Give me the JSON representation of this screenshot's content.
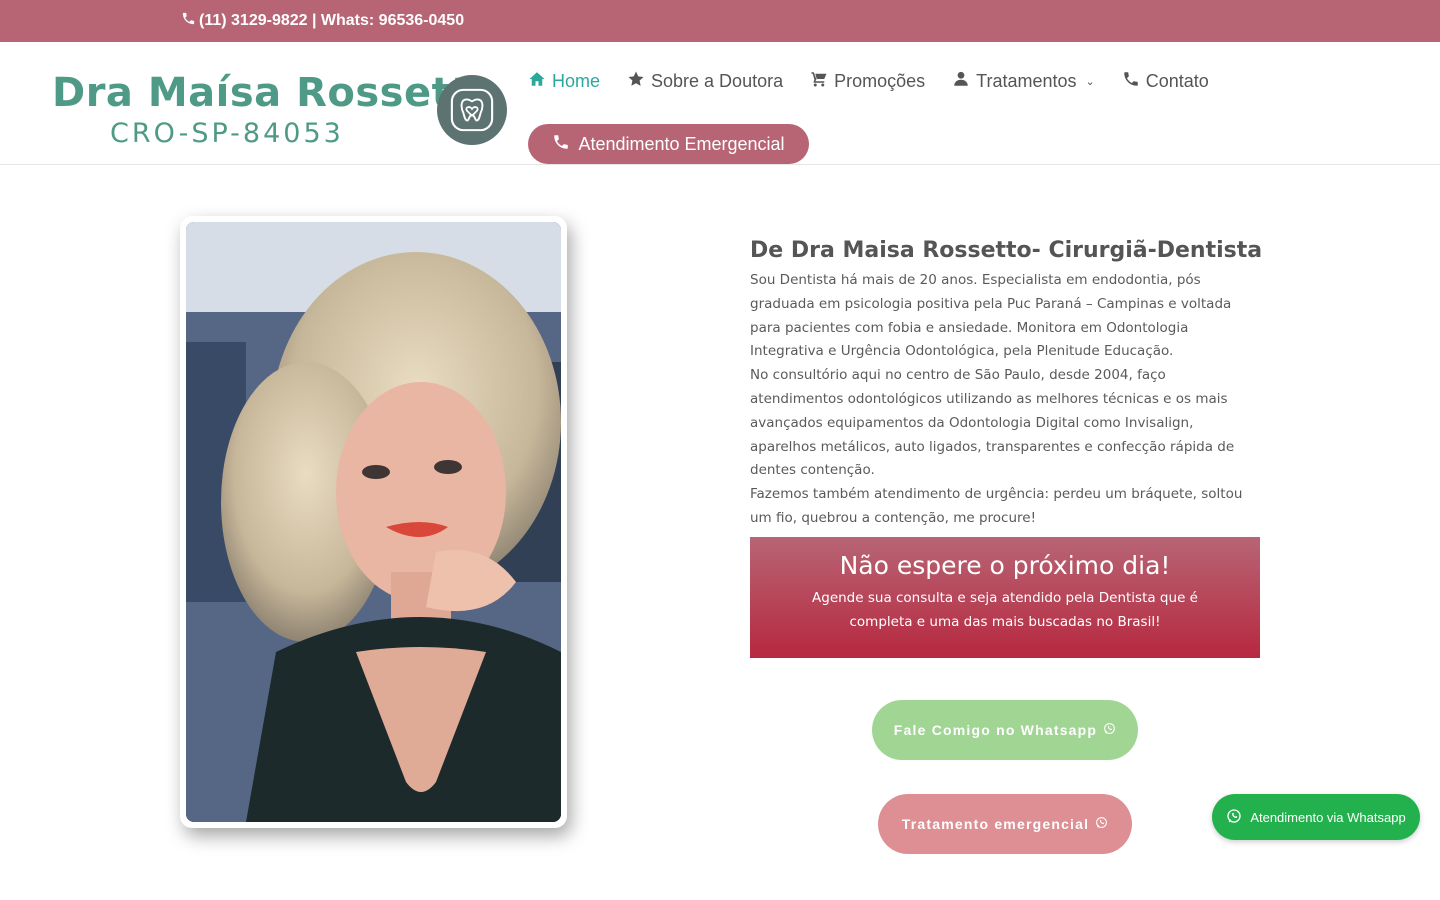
{
  "topbar": {
    "contact_text": "(11) 3129-9822 | Whats: 96536-0450",
    "icon": "phone-icon"
  },
  "logo": {
    "name": "Dra Maísa Rossetto",
    "registration": "CRO-SP-84053",
    "badge_icon": "tooth-heart-icon"
  },
  "nav": {
    "items": [
      {
        "label": "Home",
        "icon": "home-icon",
        "active": true
      },
      {
        "label": "Sobre a Doutora",
        "icon": "star-icon"
      },
      {
        "label": "Promoções",
        "icon": "cart-icon"
      },
      {
        "label": "Tratamentos",
        "icon": "user-icon",
        "has_dropdown": true
      },
      {
        "label": "Contato",
        "icon": "phone-icon"
      }
    ],
    "emergency_label": "Atendimento Emergencial"
  },
  "about": {
    "title": "De Dra Maisa Rossetto- Cirurgiã-Dentista",
    "paragraphs": [
      "Sou Dentista há mais de 20 anos. Especialista em endodontia, pós graduada em psicologia positiva pela Puc Paraná – Campinas e voltada para pacientes com fobia e ansiedade. Monitora em Odontologia Integrativa e Urgência Odontológica, pela Plenitude Educação.",
      "No consultório aqui no centro de São Paulo, desde 2004, faço atendimentos odontológicos utilizando as melhores técnicas e os mais avançados equipamentos da Odontologia Digital como Invisalign, aparelhos metálicos, auto ligados, transparentes e confecção rápida de dentes contenção.",
      "Fazemos também atendimento de urgência: perdeu um bráquete, soltou um fio, quebrou a contenção, me procure!"
    ]
  },
  "cta": {
    "title": "Não espere o próximo dia!",
    "text": "Agende sua consulta e seja atendido pela Dentista que é completa e uma das mais buscadas no Brasil!"
  },
  "buttons": {
    "whatsapp_label": "Fale Comigo no Whatsapp",
    "emergency_label": "Tratamento emergencial",
    "float_label": "Atendimento via Whatsapp"
  },
  "colors": {
    "brand": "#b76575",
    "accent": "#2ba89b",
    "logo": "#4f9a86",
    "whatsapp": "#23b14d"
  }
}
